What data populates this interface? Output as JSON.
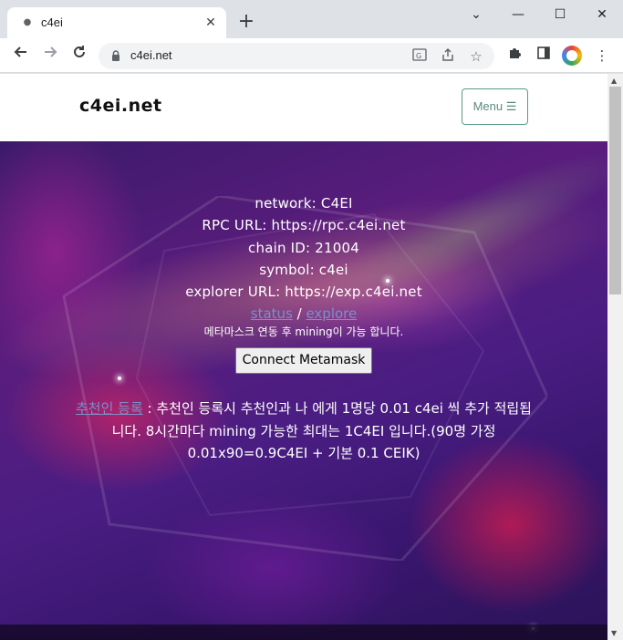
{
  "browser": {
    "tab_title": "c4ei",
    "tab_close": "✕",
    "new_tab": "+",
    "url": "c4ei.net",
    "window_controls": {
      "chevron": "⌄",
      "minimize": "—",
      "maximize": "☐",
      "close": "✕"
    }
  },
  "site": {
    "brand": "c4ei.net",
    "menu_label": "Menu ☰"
  },
  "network_info": {
    "network": "network: C4EI",
    "rpc_url": "RPC URL: https://rpc.c4ei.net",
    "chain_id": "chain ID: 21004",
    "symbol": "symbol: c4ei",
    "explorer_url": "explorer URL: https://exp.c4ei.net",
    "status_link": "status",
    "link_separator": " / ",
    "explore_link": "explore",
    "metamask_note": "메타마스크 연동 후 mining이 가능 합니다.",
    "connect_button": "Connect Metamask"
  },
  "referral": {
    "link": "추천인 등록",
    "text": " : 추천인 등록시 추천인과 나 에게 1명당 0.01 c4ei 씩 추가 적립됩니다. 8시간마다 mining 가능한 최대는 1C4EI 입니다.(90명 가정 0.01x90=0.9C4EI + 기본 0.1 CEIK)"
  }
}
